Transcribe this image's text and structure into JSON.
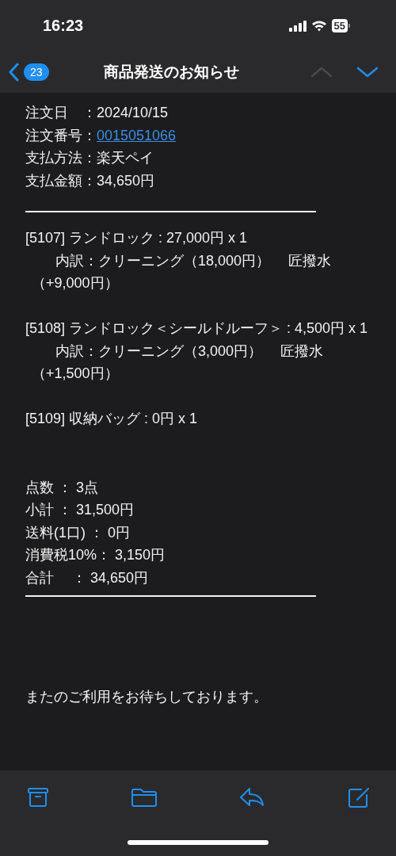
{
  "status_bar": {
    "time": "16:23",
    "battery": "55"
  },
  "nav": {
    "unread_count": "23",
    "title": "商品発送のお知らせ",
    "arrows": [
      {
        "kind": "up",
        "disabled": true
      },
      {
        "kind": "down",
        "disabled": false
      }
    ]
  },
  "order_fields": [
    {
      "label": "注文日　：",
      "value": "2024/10/15",
      "kind": "text"
    },
    {
      "label": "注文番号：",
      "value": "0015051066",
      "kind": "link"
    },
    {
      "label": "支払方法：",
      "value": "楽天ペイ",
      "kind": "text"
    },
    {
      "label": "支払金額：",
      "value": "34,650円",
      "kind": "text"
    }
  ],
  "items": [
    {
      "line": "[5107] ランドロック : 27,000円 x 1",
      "detail": "内訳：クリーニング（18,000円）　 匠撥水（+9,000円）"
    },
    {
      "line": "[5108] ランドロック＜シールドルーフ＞ : 4,500円 x 1",
      "detail": "内訳：クリーニング（3,000円）　 匠撥水（+1,500円）"
    },
    {
      "line": "[5109] 収納バッグ : 0円 x 1"
    }
  ],
  "summary": [
    "点数 ： 3点",
    "小計 ： 31,500円",
    "送料(1口) ： 0円",
    "消費税10%： 3,150円",
    "合計　 ： 34,650円"
  ],
  "closing": "またのご利用をお待ちしております。",
  "toolbar": [
    {
      "kind": "archive"
    },
    {
      "kind": "folder"
    },
    {
      "kind": "reply"
    },
    {
      "kind": "compose"
    }
  ]
}
